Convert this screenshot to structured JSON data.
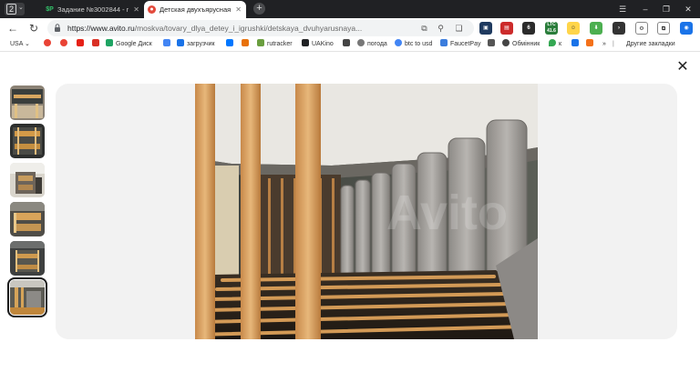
{
  "browser": {
    "tab_counter": "2",
    "tabs": [
      {
        "title": "Задание №3002844 - про",
        "favicon": "$P"
      },
      {
        "title": "Детская двухъярусная к",
        "favicon": "●"
      }
    ],
    "new_tab": "+",
    "url_domain": "https://www.avito.ru",
    "url_path": "/moskva/tovary_dlya_detey_i_igrushki/detskaya_dvuhyarusnaya...",
    "extensions": [
      {
        "label": "6",
        "color": "#2b2b2b"
      },
      {
        "label": "LTC",
        "color": "#2a7d3b"
      },
      {
        "label": "41.6",
        "color": "#2a7d3b"
      }
    ]
  },
  "bookmarks": [
    {
      "label": "USA",
      "color": "#ffffff"
    },
    {
      "label": "",
      "color": "#e94335"
    },
    {
      "label": "",
      "color": "#e94335"
    },
    {
      "label": "",
      "color": "#e62117"
    },
    {
      "label": "",
      "color": "#d93025"
    },
    {
      "label": "Google Диск",
      "color": "#1fa463"
    },
    {
      "label": "",
      "color": "#4285f4"
    },
    {
      "label": "загрузчик",
      "color": "#1a73e8"
    },
    {
      "label": "",
      "color": "#0077ff"
    },
    {
      "label": "",
      "color": "#e8710a"
    },
    {
      "label": "rutracker",
      "color": "#6a9e3f"
    },
    {
      "label": "UAKino",
      "color": "#202124"
    },
    {
      "label": "",
      "color": "#444444"
    },
    {
      "label": "погода",
      "color": "#777777"
    },
    {
      "label": "btc to usd",
      "color": "#4285f4"
    },
    {
      "label": "FaucetPay",
      "color": "#3b7ddd"
    },
    {
      "label": "",
      "color": "#555555"
    },
    {
      "label": "Обмінник",
      "color": "#444444"
    },
    {
      "label": "к",
      "color": "#34a853"
    },
    {
      "label": "»",
      "color": "#ffffff"
    },
    {
      "label": "Другие закладки",
      "color": "#f6c042"
    }
  ],
  "gallery": {
    "close_label": "✕",
    "thumbnails": 6,
    "active_thumbnail": 6,
    "watermark": "Avito"
  },
  "colors": {
    "accent": "#1a73e8",
    "tabbar": "#202124",
    "stage": "#f2f2f2"
  }
}
